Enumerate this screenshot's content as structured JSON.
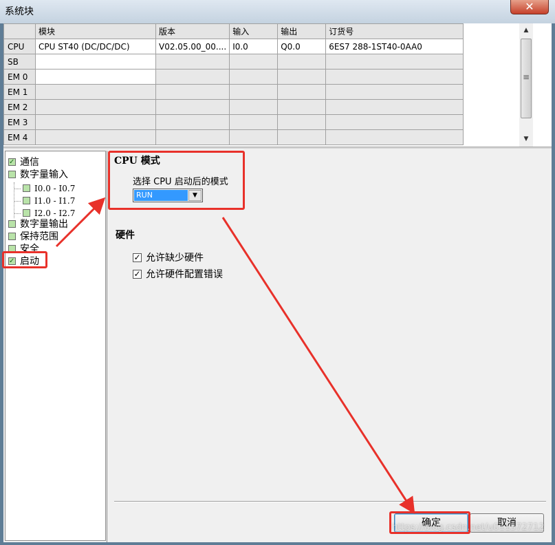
{
  "window": {
    "title": "系统块",
    "close_label": "✕"
  },
  "grid": {
    "columns": [
      "",
      "模块",
      "版本",
      "输入",
      "输出",
      "订货号"
    ],
    "rows": [
      {
        "slot": "CPU",
        "module": "CPU ST40 (DC/DC/DC)",
        "version": "V02.05.00_00....",
        "input": "I0.0",
        "output": "Q0.0",
        "order": "6ES7 288-1ST40-0AA0"
      },
      {
        "slot": "SB",
        "module": "",
        "version": "",
        "input": "",
        "output": "",
        "order": ""
      },
      {
        "slot": "EM 0",
        "module": "",
        "version": "",
        "input": "",
        "output": "",
        "order": ""
      },
      {
        "slot": "EM 1",
        "module": "",
        "version": "",
        "input": "",
        "output": "",
        "order": ""
      },
      {
        "slot": "EM 2",
        "module": "",
        "version": "",
        "input": "",
        "output": "",
        "order": ""
      },
      {
        "slot": "EM 3",
        "module": "",
        "version": "",
        "input": "",
        "output": "",
        "order": ""
      },
      {
        "slot": "EM 4",
        "module": "",
        "version": "",
        "input": "",
        "output": "",
        "order": ""
      }
    ]
  },
  "tree": {
    "items": [
      {
        "label": "通信",
        "level": 0
      },
      {
        "label": "数字量输入",
        "level": 0
      },
      {
        "label": "I0.0 - I0.7",
        "level": 1
      },
      {
        "label": "I1.0 - I1.7",
        "level": 1
      },
      {
        "label": "I2.0 - I2.7",
        "level": 1
      },
      {
        "label": "数字量输出",
        "level": 0
      },
      {
        "label": "保持范围",
        "level": 0
      },
      {
        "label": "安全",
        "level": 0
      },
      {
        "label": "启动",
        "level": 0,
        "selected": true
      }
    ]
  },
  "panel": {
    "cpu_mode_heading": "CPU 模式",
    "startup_mode_label": "选择 CPU 启动后的模式",
    "startup_mode_value": "RUN",
    "hardware_heading": "硬件",
    "allow_missing_hw": {
      "label": "允许缺少硬件",
      "checked": true
    },
    "allow_hw_config_errors": {
      "label": "允许硬件配置错误",
      "checked": true
    }
  },
  "buttons": {
    "ok": "确定",
    "cancel": "取消"
  },
  "watermark": "https://blog.csdn.net/u011572712",
  "colors": {
    "annotation_red": "#e8312a",
    "selection_blue": "#3399ff"
  }
}
